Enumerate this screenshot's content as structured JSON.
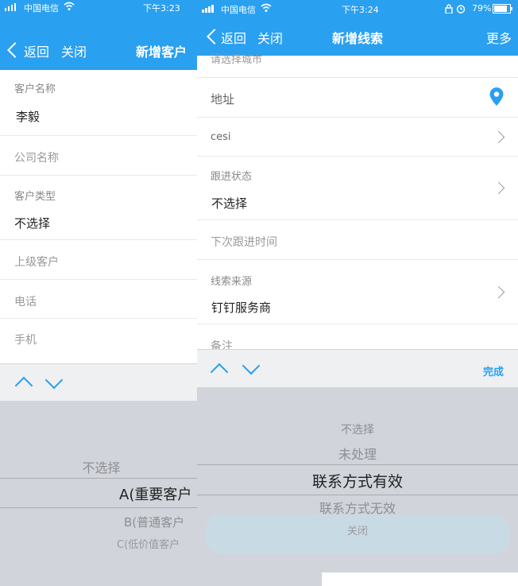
{
  "left": {
    "status": {
      "carrier": "中国电信",
      "time": "下午3:23"
    },
    "nav": {
      "back": "返回",
      "close": "关闭",
      "title": "新增客户"
    },
    "form": {
      "customer_name_label": "客户名称",
      "customer_name_value": "李毅",
      "company_name_placeholder": "公司名称",
      "customer_type_label": "客户类型",
      "customer_type_value": "不选择",
      "parent_customer_placeholder": "上级客户",
      "phone_placeholder": "电话",
      "mobile_placeholder": "手机"
    },
    "picker": {
      "options": [
        "不选择",
        "A(重要客户",
        "B(普通客户",
        "C(低价值客户"
      ]
    }
  },
  "right": {
    "status": {
      "carrier": "中国电信",
      "time": "下午3:24",
      "battery": "79%"
    },
    "nav": {
      "back": "返回",
      "close": "关闭",
      "title": "新增线索",
      "more": "更多"
    },
    "form": {
      "partial_top": "请选择城市",
      "address_placeholder": "地址",
      "cesi_value": "cesi",
      "follow_status_label": "跟进状态",
      "follow_status_value": "不选择",
      "next_follow_time_placeholder": "下次跟进时间",
      "lead_source_label": "线索来源",
      "lead_source_value": "钉钉服务商",
      "remark_placeholder": "备注"
    },
    "toolbar": {
      "done": "完成"
    },
    "picker": {
      "options": [
        "不选择",
        "未处理",
        "联系方式有效",
        "联系方式无效",
        "关闭"
      ]
    }
  },
  "colors": {
    "accent": "#2aa0f0",
    "picker_bg": "#d1d4da",
    "toolbar_bg": "#eff0f2"
  }
}
